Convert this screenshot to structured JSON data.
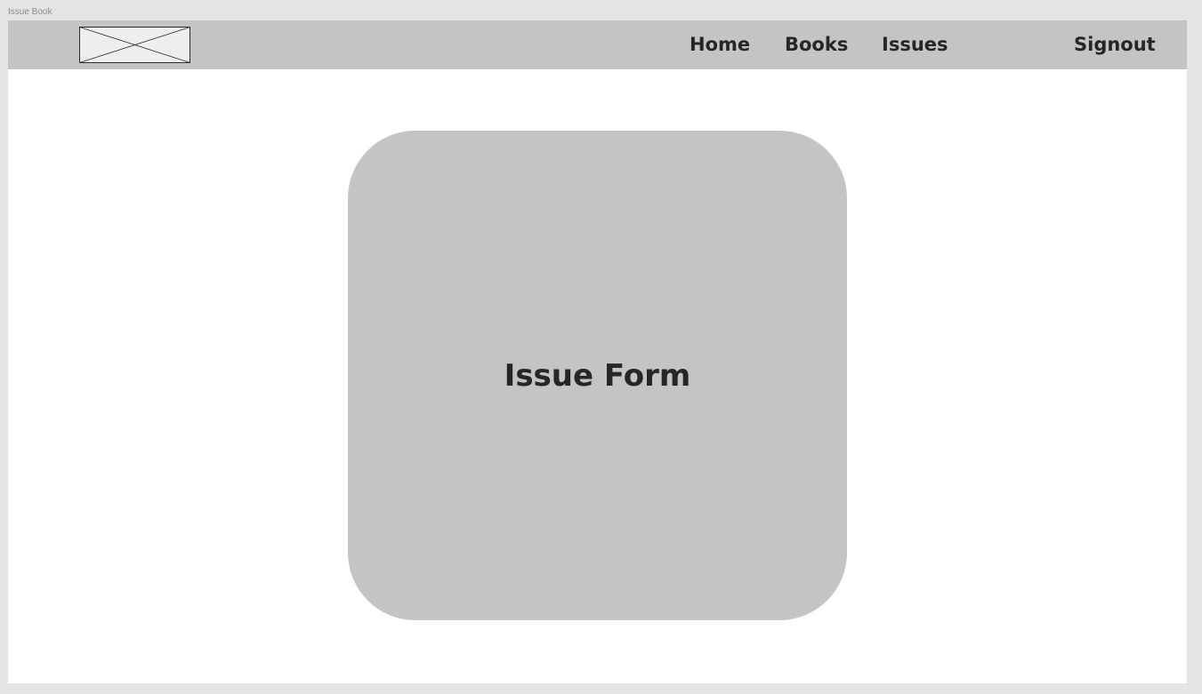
{
  "frame": {
    "label": "Issue Book"
  },
  "navbar": {
    "logo_icon": "image-placeholder-icon",
    "links": {
      "home": "Home",
      "books": "Books",
      "issues": "Issues",
      "signout": "Signout"
    }
  },
  "main": {
    "card_title": "Issue Form"
  },
  "colors": {
    "canvas": "#e4e4e4",
    "navbar": "#c4c4c4",
    "card": "#c4c4c4",
    "text": "#262626"
  }
}
